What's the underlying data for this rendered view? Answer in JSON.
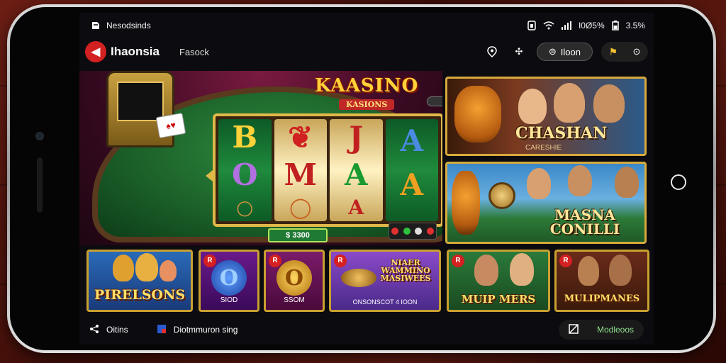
{
  "statusbar": {
    "app_name": "Nesodsinds",
    "time_text": "I0Ø5%",
    "battery_text": "3.5%"
  },
  "appbar": {
    "title": "Ihaonsia",
    "subtitle": "Fasock",
    "pill_label": "Iloon"
  },
  "hero": {
    "logo_main": "KAASINO",
    "logo_sub": "KASIONS",
    "reel_symbols": [
      [
        "B",
        "O",
        "○"
      ],
      [
        "❦",
        "M",
        "◯"
      ],
      [
        "J",
        "A",
        "A"
      ],
      [
        "A",
        "A",
        ""
      ]
    ],
    "credit": "$ 3300"
  },
  "features": [
    {
      "title": "CHASHAN",
      "subtitle": "CARESHIE"
    },
    {
      "title": "MASNA CONILLI"
    }
  ],
  "tiles": [
    {
      "label": "PIRELSONS",
      "tag": ""
    },
    {
      "label": "SIOD",
      "tag": "R",
      "coin": "O"
    },
    {
      "label": "SSOM",
      "tag": "R",
      "coin": "O"
    },
    {
      "label": "NIAER WAMMINO MASIWEES",
      "sub": "ONSONSCOT 4 IOON",
      "tag": "R"
    },
    {
      "label": "MUIP MERS",
      "tag": "R"
    },
    {
      "label": "MULIPMANES",
      "tag": "R"
    }
  ],
  "bottombar": {
    "left_label": "Oitins",
    "mid_label": "Diotmmuron sing",
    "right_label": "Modleoos"
  },
  "colors": {
    "accent_red": "#d32020",
    "gold": "#d7a93c",
    "felt_green": "#1a5e28"
  },
  "icons": {
    "notif": "notification-icon",
    "wifi": "wifi-icon",
    "signal": "signal-icon",
    "battery": "battery-icon",
    "back": "back-arrow-icon",
    "location": "location-icon",
    "settings": "puzzle-icon",
    "share": "share-icon",
    "grid": "grid-icon"
  }
}
